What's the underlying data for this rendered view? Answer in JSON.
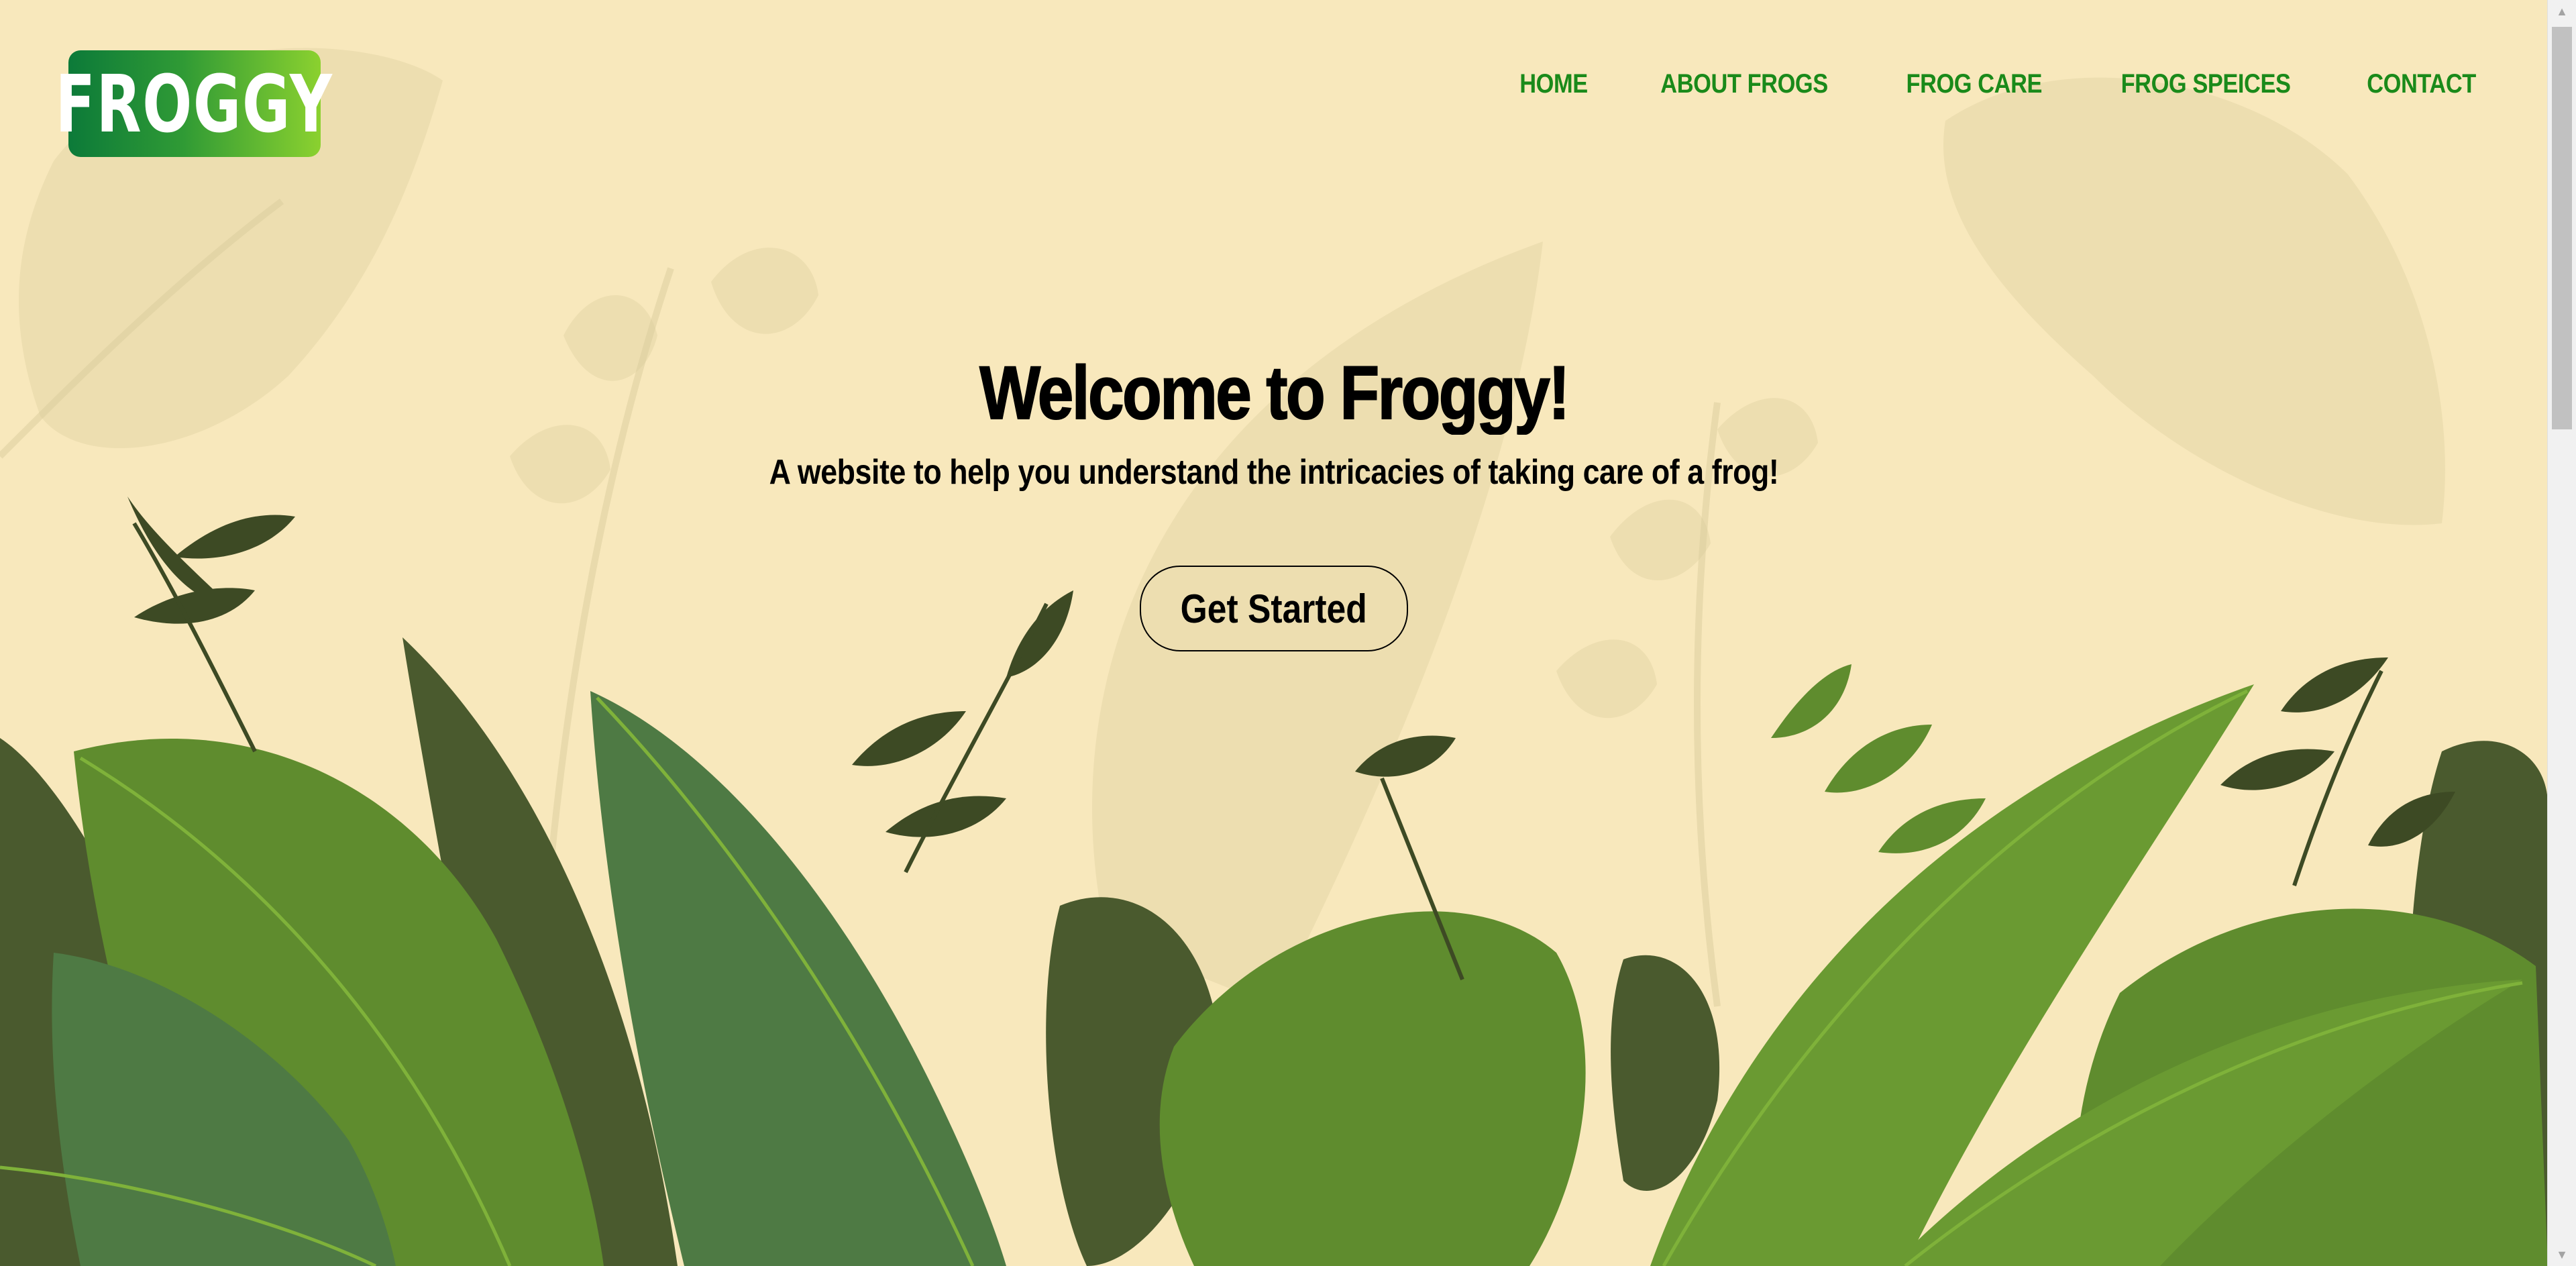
{
  "brand": {
    "logo_text": "FROGGY"
  },
  "nav": {
    "items": [
      {
        "label": "HOME"
      },
      {
        "label": "ABOUT FROGS"
      },
      {
        "label": "FROG CARE"
      },
      {
        "label": "FROG SPEICES"
      },
      {
        "label": "CONTACT"
      }
    ]
  },
  "hero": {
    "title": "Welcome to Froggy!",
    "subtitle": "A website to help you understand the intricacies of taking care of a frog!",
    "cta_label": "Get Started"
  },
  "colors": {
    "background": "#f8e8bc",
    "nav_text": "#1a8a1a",
    "logo_gradient_start": "#0c7a39",
    "logo_gradient_end": "#8bd12f"
  }
}
